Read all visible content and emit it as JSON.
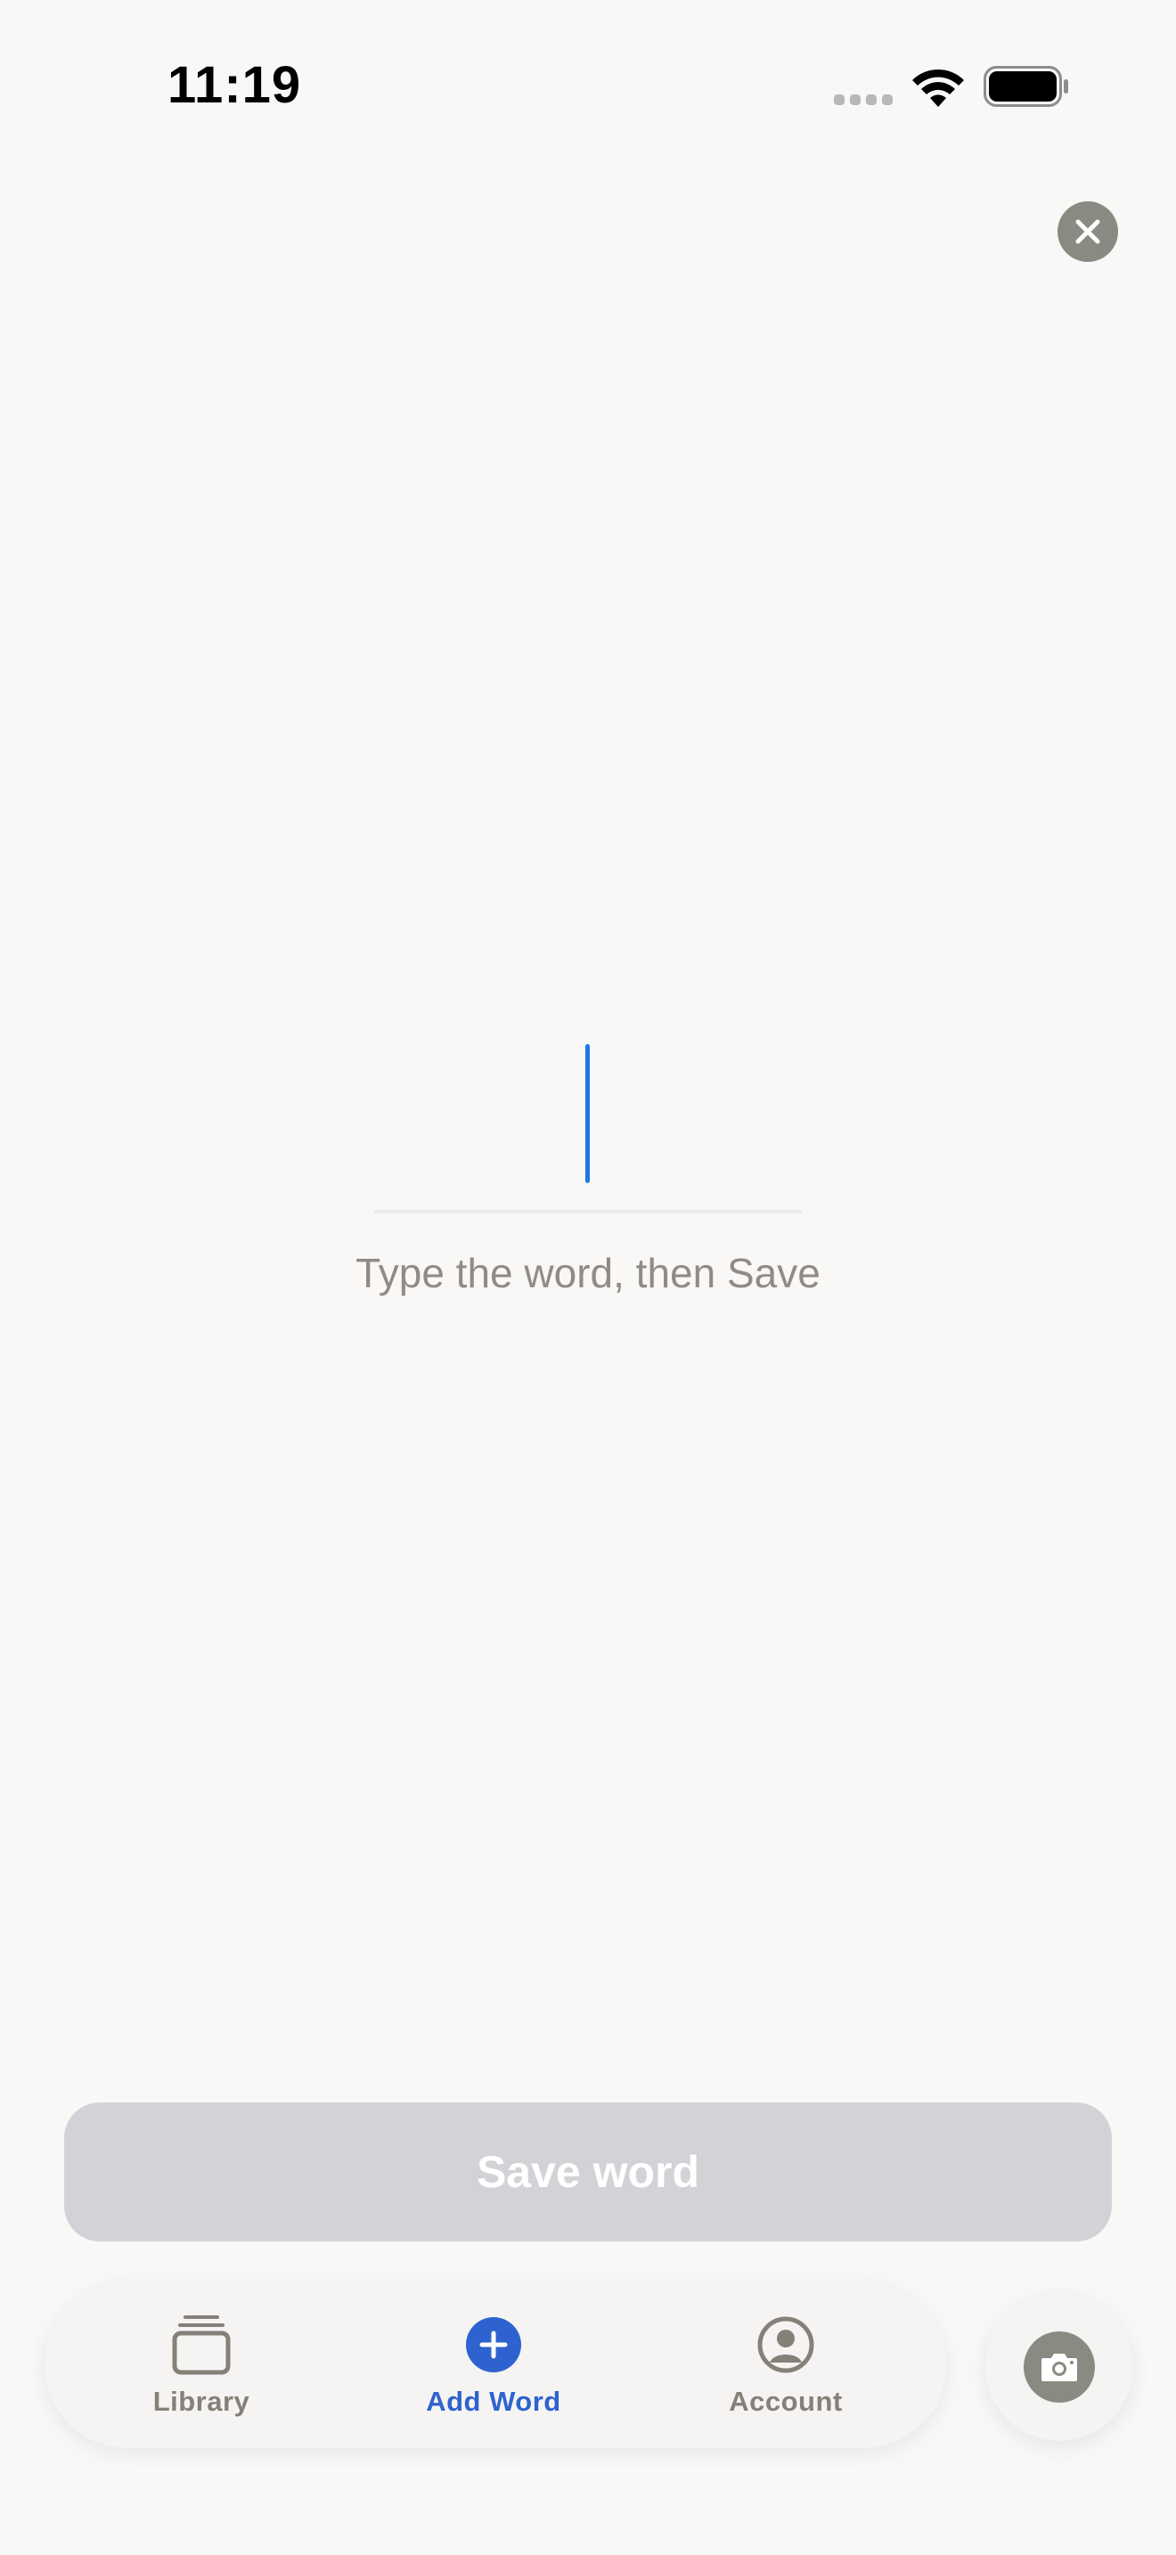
{
  "status_bar": {
    "time": "11:19",
    "signal_icon": "cellular-dots-icon",
    "wifi_icon": "wifi-icon",
    "battery_icon": "battery-icon"
  },
  "close_button": {
    "icon": "close-icon",
    "color": "#8b8a82"
  },
  "word_entry": {
    "value": "",
    "hint": "Type the word, then Save",
    "caret_color": "#1a7be6"
  },
  "save_button": {
    "label": "Save word",
    "background": "#d3d2d6",
    "enabled": false
  },
  "tab_bar": {
    "tabs": [
      {
        "label": "Library",
        "icon": "stacked-cards-icon",
        "active": false
      },
      {
        "label": "Add Word",
        "icon": "plus-circle-icon",
        "active": true
      },
      {
        "label": "Account",
        "icon": "person-circle-icon",
        "active": false
      }
    ],
    "active_color": "#2e63cf",
    "inactive_color": "#838178"
  },
  "camera_button": {
    "icon": "camera-icon"
  }
}
